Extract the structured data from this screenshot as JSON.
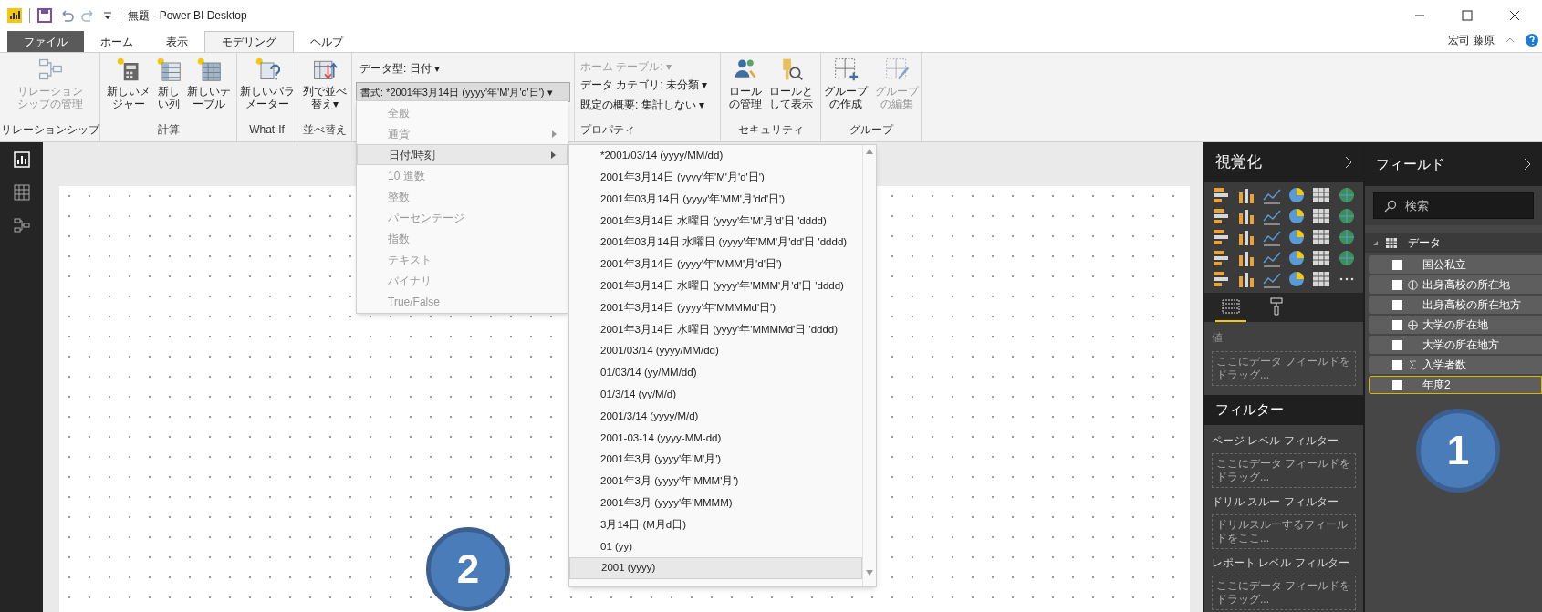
{
  "title_bar": {
    "title": "無題 - Power BI Desktop"
  },
  "menu_tabs": [
    {
      "label": "ファイル",
      "kind": "file",
      "selected": false
    },
    {
      "label": "ホーム",
      "kind": "tab",
      "selected": false
    },
    {
      "label": "表示",
      "kind": "tab",
      "selected": false
    },
    {
      "label": "モデリング",
      "kind": "tab",
      "selected": true
    },
    {
      "label": "ヘルプ",
      "kind": "tab",
      "selected": false
    }
  ],
  "user_name": "宏司 藤原",
  "ribbon_groups": [
    {
      "label": "リレーションシップ",
      "buttons": [
        {
          "label": "リレーションシップの管理",
          "kind": "relationships",
          "disabled": true
        }
      ]
    },
    {
      "label": "計算",
      "buttons": [
        {
          "label": "新しいメジャー",
          "kind": "measure",
          "disabled": false
        },
        {
          "label": "新しい列",
          "kind": "column",
          "disabled": false
        },
        {
          "label": "新しいテーブル",
          "kind": "table",
          "disabled": false
        }
      ]
    },
    {
      "label": "What-If",
      "buttons": [
        {
          "label": "新しいパラメーター",
          "kind": "parameter",
          "disabled": false
        }
      ]
    },
    {
      "label": "並べ替え",
      "buttons": [
        {
          "label": "列で並べ替え▾",
          "kind": "sort",
          "disabled": false
        }
      ]
    }
  ],
  "data_type": "データ型: 日付 ▾",
  "format": "書式: *2001年3月14日 (yyyy'年'M'月'd'日') ▾",
  "properties": {
    "label": "プロパティ",
    "home_table": "ホーム テーブル: ▾",
    "data_category": "データ カテゴリ: 未分類 ▾",
    "default_summary": "既定の概要: 集計しない ▾"
  },
  "ribbon_groups_right": [
    {
      "label": "セキュリティ",
      "buttons": [
        {
          "label": "ロールの管理",
          "kind": "roles",
          "disabled": false
        },
        {
          "label": "ロールとして表示",
          "kind": "view-as",
          "disabled": false
        }
      ]
    },
    {
      "label": "グループ",
      "buttons": [
        {
          "label": "グループの作成",
          "kind": "new-group",
          "disabled": false
        },
        {
          "label": "グループの編集",
          "kind": "edit-group",
          "disabled": true
        }
      ]
    }
  ],
  "format_menu": [
    {
      "label": "全般",
      "submenu": false,
      "selected": false
    },
    {
      "label": "通貨",
      "submenu": true,
      "selected": false
    },
    {
      "label": "日付/時刻",
      "submenu": true,
      "selected": true
    },
    {
      "label": "10 進数",
      "submenu": false,
      "selected": false
    },
    {
      "label": "整数",
      "submenu": false,
      "selected": false
    },
    {
      "label": "パーセンテージ",
      "submenu": false,
      "selected": false
    },
    {
      "label": "指数",
      "submenu": false,
      "selected": false
    },
    {
      "label": "テキスト",
      "submenu": false,
      "selected": false
    },
    {
      "label": "バイナリ",
      "submenu": false,
      "selected": false
    },
    {
      "label": "True/False",
      "submenu": false,
      "selected": false
    }
  ],
  "date_menu": [
    {
      "label": "*2001/03/14 (yyyy/MM/dd)",
      "selected": false
    },
    {
      "label": "2001年3月14日 (yyyy'年'M'月'd'日')",
      "selected": false
    },
    {
      "label": "2001年03月14日 (yyyy'年'MM'月'dd'日')",
      "selected": false
    },
    {
      "label": "2001年3月14日 水曜日 (yyyy'年'M'月'd'日 'dddd)",
      "selected": false
    },
    {
      "label": "2001年03月14日 水曜日 (yyyy'年'MM'月'dd'日 'dddd)",
      "selected": false
    },
    {
      "label": "2001年3月14日 (yyyy'年'MMM'月'd'日')",
      "selected": false
    },
    {
      "label": "2001年3月14日 水曜日 (yyyy'年'MMM'月'd'日 'dddd)",
      "selected": false
    },
    {
      "label": "2001年3月14日 (yyyy'年'MMMMd'日')",
      "selected": false
    },
    {
      "label": "2001年3月14日 水曜日 (yyyy'年'MMMMd'日 'dddd)",
      "selected": false
    },
    {
      "label": "2001/03/14 (yyyy/MM/dd)",
      "selected": false
    },
    {
      "label": "01/03/14 (yy/MM/dd)",
      "selected": false
    },
    {
      "label": "01/3/14 (yy/M/d)",
      "selected": false
    },
    {
      "label": "2001/3/14 (yyyy/M/d)",
      "selected": false
    },
    {
      "label": "2001-03-14 (yyyy-MM-dd)",
      "selected": false
    },
    {
      "label": "2001年3月 (yyyy'年'M'月')",
      "selected": false
    },
    {
      "label": "2001年3月 (yyyy'年'MMM'月')",
      "selected": false
    },
    {
      "label": "2001年3月 (yyyy'年'MMMM)",
      "selected": false
    },
    {
      "label": "3月14日 (M月d日)",
      "selected": false
    },
    {
      "label": "01 (yy)",
      "selected": false
    },
    {
      "label": "2001 (yyyy)",
      "selected": true
    }
  ],
  "visualizations": {
    "title": "視覚化",
    "pane_tabs": [
      {
        "kind": "fields",
        "selected": true
      },
      {
        "kind": "format",
        "selected": false
      }
    ],
    "values_label": "値",
    "values_placeholder": "ここにデータ フィールドをドラッグ..."
  },
  "filters": {
    "title": "フィルター",
    "sections": [
      {
        "label": "ページ レベル フィルター",
        "placeholder": "ここにデータ フィールドをドラッグ..."
      },
      {
        "label": "ドリル スルー フィルター",
        "placeholder": "ドリルスルーするフィールドをここ..."
      },
      {
        "label": "レポート レベル フィルター",
        "placeholder": "ここにデータ フィールドをドラッグ..."
      }
    ]
  },
  "fields": {
    "title": "フィールド",
    "search_placeholder": "検索",
    "table": {
      "name": "データ",
      "expanded": true,
      "fields": [
        {
          "name": "国公私立",
          "kind": "text",
          "checked": false,
          "selected": false
        },
        {
          "name": "出身高校の所在地",
          "kind": "geo",
          "checked": false,
          "selected": false
        },
        {
          "name": "出身高校の所在地方",
          "kind": "text",
          "checked": false,
          "selected": false
        },
        {
          "name": "大学の所在地",
          "kind": "geo",
          "checked": false,
          "selected": false
        },
        {
          "name": "大学の所在地方",
          "kind": "text",
          "checked": false,
          "selected": false
        },
        {
          "name": "入学者数",
          "kind": "sum",
          "checked": false,
          "selected": false
        },
        {
          "name": "年度2",
          "kind": "text",
          "checked": false,
          "selected": true
        }
      ]
    }
  },
  "callouts": [
    {
      "label": "1"
    },
    {
      "label": "2"
    }
  ]
}
